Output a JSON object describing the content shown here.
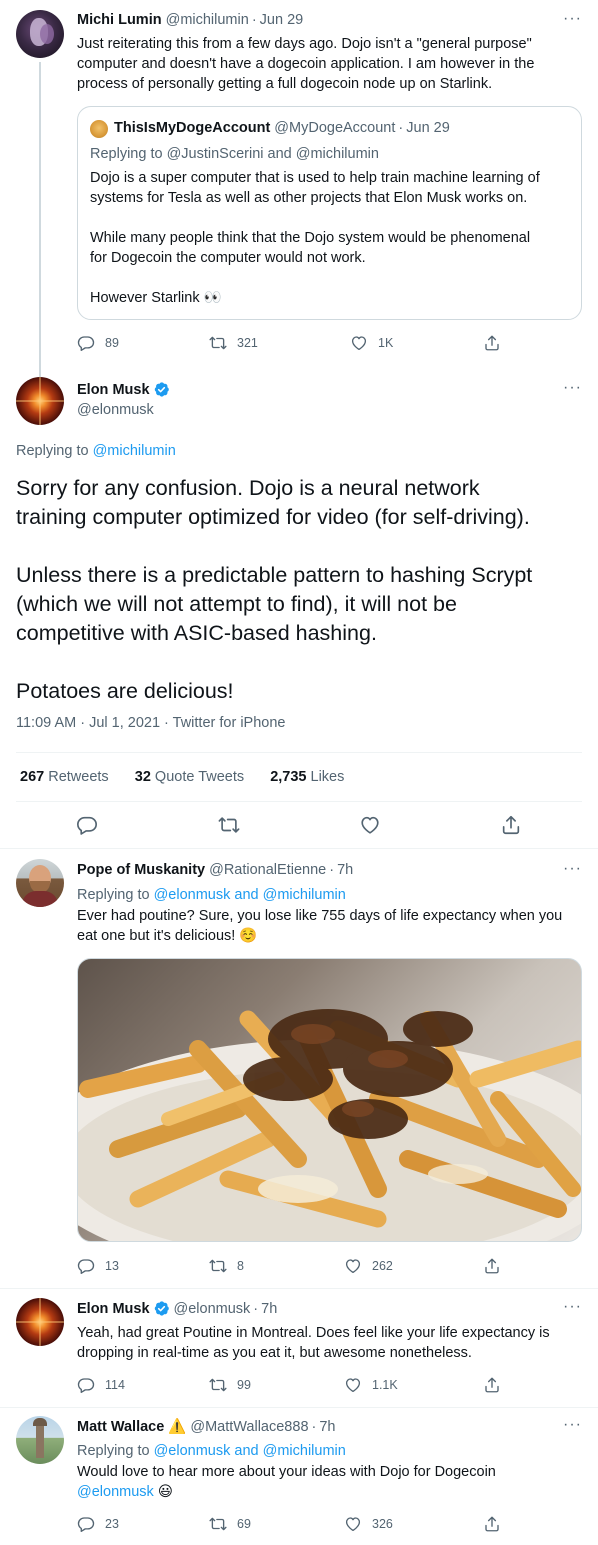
{
  "tweet1": {
    "display_name": "Michi Lumin",
    "handle": "@michilumin",
    "time": "Jun 29",
    "lines": [
      "Just reiterating this from a few days ago.  Dojo isn't a \"general purpose\"",
      "computer and doesn't have a dogecoin application.  I am however in the",
      "process of personally getting a full dogecoin node up on Starlink."
    ],
    "quote": {
      "display_name": "ThisIsMyDogeAccount",
      "handle": "@MyDogeAccount",
      "time": "Jun 29",
      "replying_prefix": "Replying to",
      "replying_to": "@JustinScerini and @michilumin",
      "para1": [
        "Dojo is a super computer that is used to help train machine learning of",
        "systems for Tesla as well as other projects that Elon Musk works on."
      ],
      "para2": [
        "While many people think that the Dojo system would be phenomenal",
        "for Dogecoin the computer would not work."
      ],
      "para3": "However Starlink 👀"
    },
    "replies": "89",
    "retweets": "321",
    "likes": "1K"
  },
  "main": {
    "display_name": "Elon Musk",
    "handle": "@elonmusk",
    "replying_prefix": "Replying to",
    "replying_to": "@michilumin",
    "para1": [
      "Sorry for any confusion. Dojo is a neural network",
      "training computer optimized for video (for self-driving)."
    ],
    "para2": [
      "Unless there is a predictable pattern to hashing Scrypt",
      "(which we will not attempt to find), it will not be",
      "competitive with ASIC-based hashing."
    ],
    "para3": "Potatoes are delicious!",
    "meta": "11:09 AM · Jul 1, 2021 · Twitter for iPhone",
    "retweets_count": "267",
    "retweets_label": "Retweets",
    "quotes_count": "32",
    "quotes_label": "Quote Tweets",
    "likes_count": "2,735",
    "likes_label": "Likes"
  },
  "reply1": {
    "display_name": "Pope of Muskanity",
    "handle": "@RationalEtienne",
    "time": "7h",
    "replying_prefix": "Replying to",
    "replying_to": "@elonmusk and @michilumin",
    "lines": [
      "Ever had poutine? Sure, you lose like 755 days of life expectancy when you",
      "eat one but it's delicious! ☺️"
    ],
    "replies": "13",
    "retweets": "8",
    "likes": "262"
  },
  "reply2": {
    "display_name": "Elon Musk",
    "handle": "@elonmusk",
    "time": "7h",
    "lines": [
      "Yeah, had great Poutine in Montreal. Does feel like your life expectancy is",
      "dropping in real-time as you eat it, but awesome nonetheless."
    ],
    "replies": "114",
    "retweets": "99",
    "likes": "1.1K"
  },
  "reply3": {
    "display_name": "Matt Wallace",
    "warning": "⚠️",
    "handle": "@MattWallace888",
    "time": "7h",
    "replying_prefix": "Replying to",
    "replying_to": "@elonmusk and @michilumin",
    "line1": "Would love to hear more about your ideas with Dojo for Dogecoin",
    "mention": "@elonmusk",
    "emoji": "😃",
    "replies": "23",
    "retweets": "69",
    "likes": "326"
  },
  "colors": {
    "accent": "#1d9bf0",
    "secondary_text": "#536471",
    "border": "#cfd9de"
  },
  "icons": [
    "reply-icon",
    "retweet-icon",
    "like-icon",
    "share-icon",
    "verified-badge-icon",
    "more-options-icon",
    "warning-icon"
  ]
}
